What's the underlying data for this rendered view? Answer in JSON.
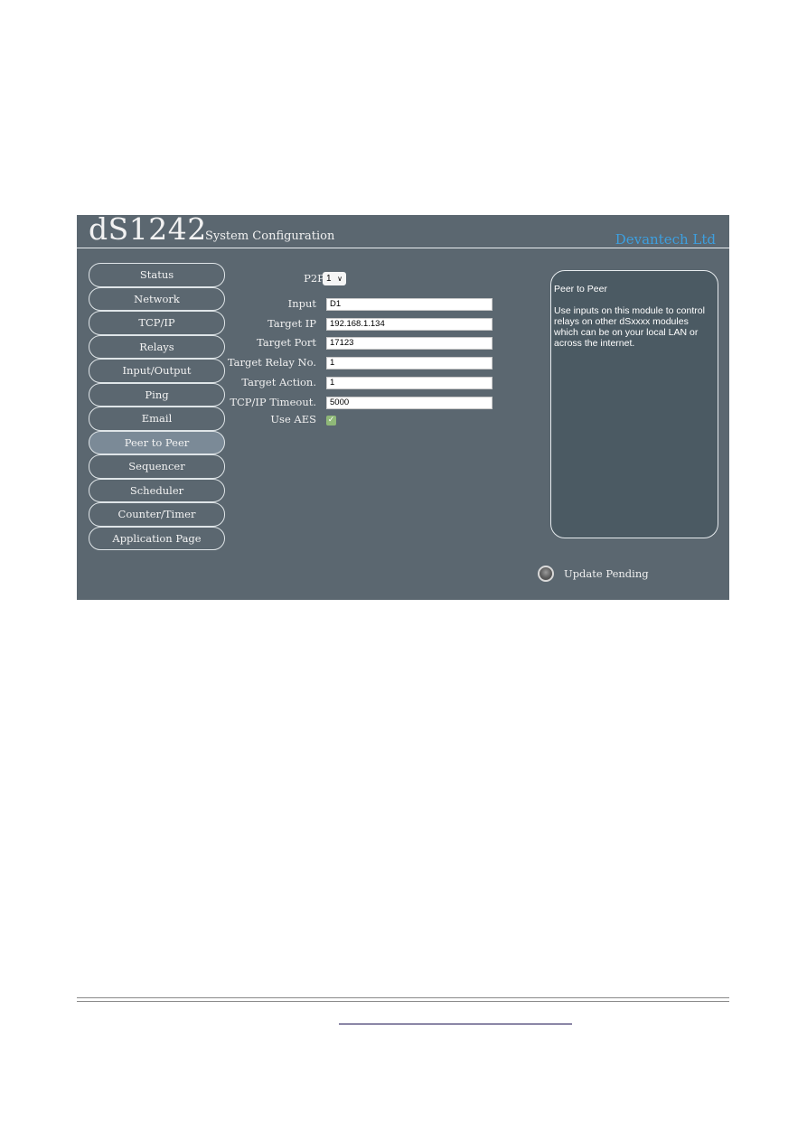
{
  "header": {
    "model": "dS1242",
    "subtitle": "System Configuration",
    "brand": "Devantech Ltd"
  },
  "colors": {
    "panel_bg": "#5b6770",
    "brand": "#3d9fdf",
    "active_nav": "#7b8a97",
    "help_bg": "#4b5a63",
    "checkbox": "#8fb878"
  },
  "sidebar": {
    "active": "Peer to Peer",
    "items": [
      {
        "label": "Status"
      },
      {
        "label": "Network"
      },
      {
        "label": "TCP/IP"
      },
      {
        "label": "Relays"
      },
      {
        "label": "Input/Output"
      },
      {
        "label": "Ping"
      },
      {
        "label": "Email"
      },
      {
        "label": "Peer to Peer"
      },
      {
        "label": "Sequencer"
      },
      {
        "label": "Scheduler"
      },
      {
        "label": "Counter/Timer"
      },
      {
        "label": "Application Page"
      }
    ]
  },
  "form": {
    "p2p_label": "P2P No.",
    "p2p_value": "1",
    "fields": [
      {
        "label": "Input",
        "value": "D1"
      },
      {
        "label": "Target IP",
        "value": "192.168.1.134"
      },
      {
        "label": "Target Port",
        "value": "17123"
      },
      {
        "label": "Target Relay No.",
        "value": "1"
      },
      {
        "label": "Target Action.",
        "value": "1"
      },
      {
        "label": "TCP/IP Timeout.",
        "value": "5000"
      }
    ],
    "aes_label": "Use AES",
    "aes_checked": true
  },
  "help": {
    "title": "Peer to Peer",
    "body": "Use inputs on this module to control relays on other dSxxxx modules which can be on your local LAN or across the internet."
  },
  "status": {
    "label": "Update Pending"
  }
}
